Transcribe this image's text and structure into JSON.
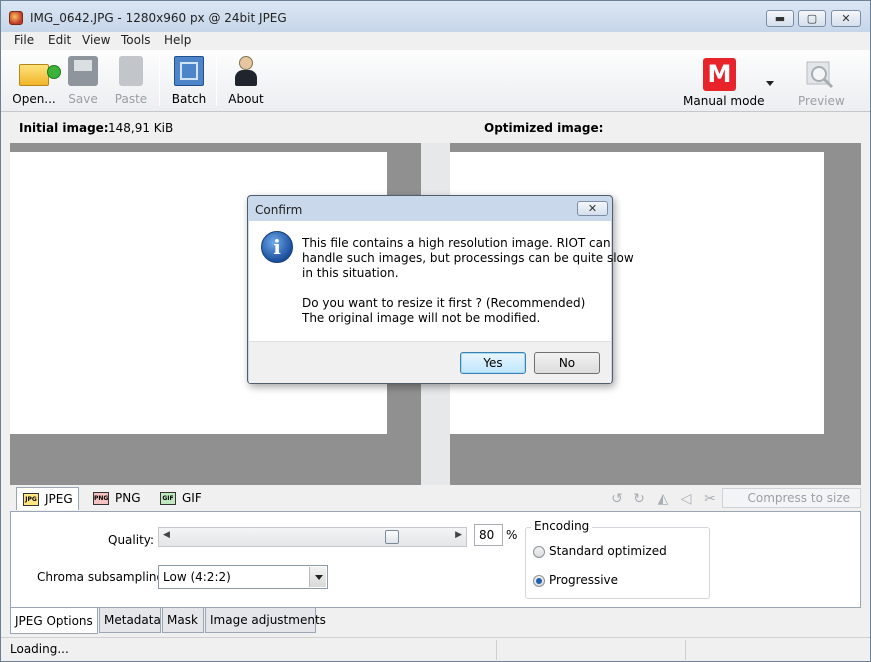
{
  "window": {
    "title": "IMG_0642.JPG - 1280x960 px @ 24bit JPEG",
    "min_label": "▬",
    "max_label": "▢",
    "close_label": "✕"
  },
  "menu": [
    "File",
    "Edit",
    "View",
    "Tools",
    "Help"
  ],
  "toolbar": {
    "open": "Open...",
    "save": "Save",
    "paste": "Paste",
    "batch": "Batch",
    "about": "About",
    "mode_icon": "M",
    "mode": "Manual mode",
    "preview": "Preview"
  },
  "images": {
    "initial_label": "Initial image:",
    "initial_size": "148,91 KiB",
    "optimized_label": "Optimized image:"
  },
  "format_tabs": [
    {
      "label": "JPEG",
      "icon": "JPG",
      "active": true
    },
    {
      "label": "PNG",
      "icon": "PNG",
      "active": false
    },
    {
      "label": "GIF",
      "icon": "GIF",
      "active": false
    }
  ],
  "tools": {
    "compress_to_size": "Compress to size"
  },
  "options": {
    "quality_label": "Quality:",
    "quality_value": "80",
    "quality_unit": "%",
    "quality_fraction": 0.8,
    "chroma_label": "Chroma subsampling:",
    "chroma_value": "Low (4:2:2)",
    "encoding_title": "Encoding",
    "encoding_options": [
      {
        "label": "Standard optimized",
        "checked": false
      },
      {
        "label": "Progressive",
        "checked": true
      }
    ]
  },
  "option_tabs": [
    "JPEG Options",
    "Metadata",
    "Mask",
    "Image adjustments"
  ],
  "status": {
    "text": "Loading..."
  },
  "dialog": {
    "title": "Confirm",
    "close_label": "✕",
    "icon_glyph": "i",
    "lines": [
      "This file contains a high resolution image. RIOT can",
      "handle such images, but processings can be quite slow",
      "in this situation.",
      "Do you want to resize it first ? (Recommended)",
      "The original image will not be modified."
    ],
    "yes": "Yes",
    "no": "No"
  },
  "colors": {
    "accent_red": "#e8232a",
    "info_blue": "#1b4f9c",
    "canvas_gray": "#909090"
  }
}
